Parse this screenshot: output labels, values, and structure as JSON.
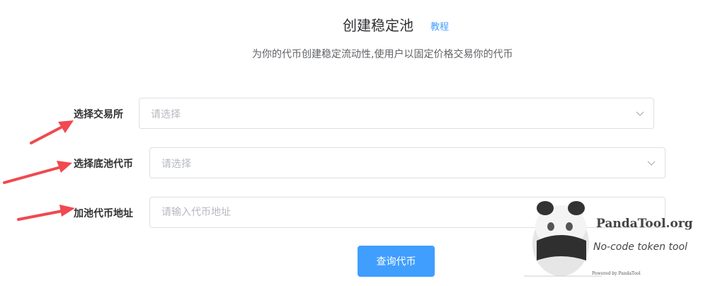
{
  "header": {
    "title": "创建稳定池",
    "tutorial_link": "教程",
    "subtitle": "为你的代币创建稳定流动性,使用户以固定价格交易你的代币"
  },
  "form": {
    "exchange": {
      "label": "选择交易所",
      "placeholder": "请选择"
    },
    "base_token": {
      "label": "选择底池代币",
      "placeholder": "请选择"
    },
    "token_address": {
      "label": "加池代币地址",
      "placeholder": "请输入代币地址"
    }
  },
  "actions": {
    "query_label": "查询代币"
  },
  "watermark": {
    "brand": "PandaTool.org",
    "tagline": "No-code token tool",
    "powered_by": "Powered by PandaTool"
  },
  "colors": {
    "primary": "#409eff",
    "annotation_arrow": "#f0494f",
    "border": "#dcdfe6",
    "placeholder": "#b6b9bf"
  }
}
